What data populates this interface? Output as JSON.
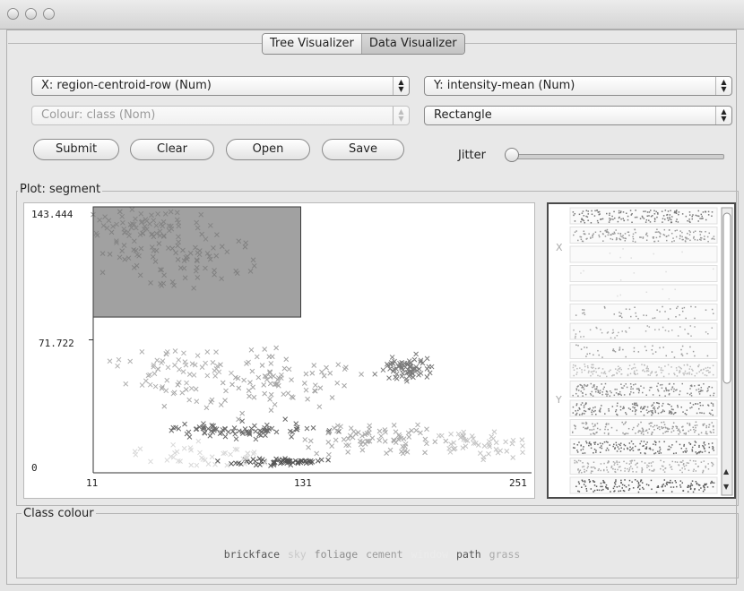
{
  "window": {
    "buttons": [
      "close",
      "minimize",
      "zoom"
    ]
  },
  "tabs": [
    {
      "label": "Tree Visualizer",
      "active": true
    },
    {
      "label": "Data Visualizer",
      "active": false
    }
  ],
  "controls": {
    "x_select": "X: region-centroid-row (Num)",
    "y_select": "Y: intensity-mean (Num)",
    "colour_select": "Colour: class (Nom)",
    "shape_select": "Rectangle",
    "submit_label": "Submit",
    "clear_label": "Clear",
    "open_label": "Open",
    "save_label": "Save",
    "jitter_label": "Jitter",
    "jitter_value": 0
  },
  "plot": {
    "group_title": "Plot: segment",
    "y_ticks": [
      "143.444",
      "71.722",
      "0"
    ],
    "x_ticks": [
      "11",
      "131",
      "251"
    ],
    "matrix_labels": {
      "x": "X",
      "y": "Y"
    }
  },
  "chart_data": {
    "type": "scatter",
    "title": "",
    "xlabel": "",
    "ylabel": "",
    "xlim": [
      11,
      251
    ],
    "ylim": [
      0,
      143.444
    ],
    "marker": "x",
    "selection_rectangle": {
      "x": [
        11,
        127
      ],
      "y": [
        84,
        143.444
      ]
    },
    "clusters": [
      {
        "shade": "#9a9a9a",
        "cx": 40,
        "cy": 132,
        "sx": 18,
        "sy": 7,
        "n": 70
      },
      {
        "shade": "#8e8e8e",
        "cx": 60,
        "cy": 115,
        "sx": 30,
        "sy": 9,
        "n": 80
      },
      {
        "shade": "#b0b0b0",
        "cx": 55,
        "cy": 55,
        "sx": 22,
        "sy": 10,
        "n": 60
      },
      {
        "shade": "#a5a5a5",
        "cx": 110,
        "cy": 48,
        "sx": 35,
        "sy": 12,
        "n": 90
      },
      {
        "shade": "#6a6a6a",
        "cx": 95,
        "cy": 23,
        "sx": 30,
        "sy": 3,
        "n": 80
      },
      {
        "shade": "#555555",
        "cx": 115,
        "cy": 6,
        "sx": 18,
        "sy": 1.5,
        "n": 60
      },
      {
        "shade": "#7a7a7a",
        "cx": 185,
        "cy": 57,
        "sx": 10,
        "sy": 5,
        "n": 70
      },
      {
        "shade": "#aaaaaa",
        "cx": 170,
        "cy": 18,
        "sx": 30,
        "sy": 6,
        "n": 80
      },
      {
        "shade": "#c4c4c4",
        "cx": 230,
        "cy": 15,
        "sx": 15,
        "sy": 6,
        "n": 45
      },
      {
        "shade": "#d8d8d8",
        "cx": 70,
        "cy": 8,
        "sx": 30,
        "sy": 5,
        "n": 40
      }
    ]
  },
  "legend": {
    "title": "Class colour",
    "classes": [
      {
        "name": "brickface",
        "color": "#555555"
      },
      {
        "name": "sky",
        "color": "#c9c9c9"
      },
      {
        "name": "foliage",
        "color": "#8e8e8e"
      },
      {
        "name": "cement",
        "color": "#9b9b9b"
      },
      {
        "name": "window",
        "color": "#ececec"
      },
      {
        "name": "path",
        "color": "#555555"
      },
      {
        "name": "grass",
        "color": "#a9a9a9"
      }
    ]
  }
}
